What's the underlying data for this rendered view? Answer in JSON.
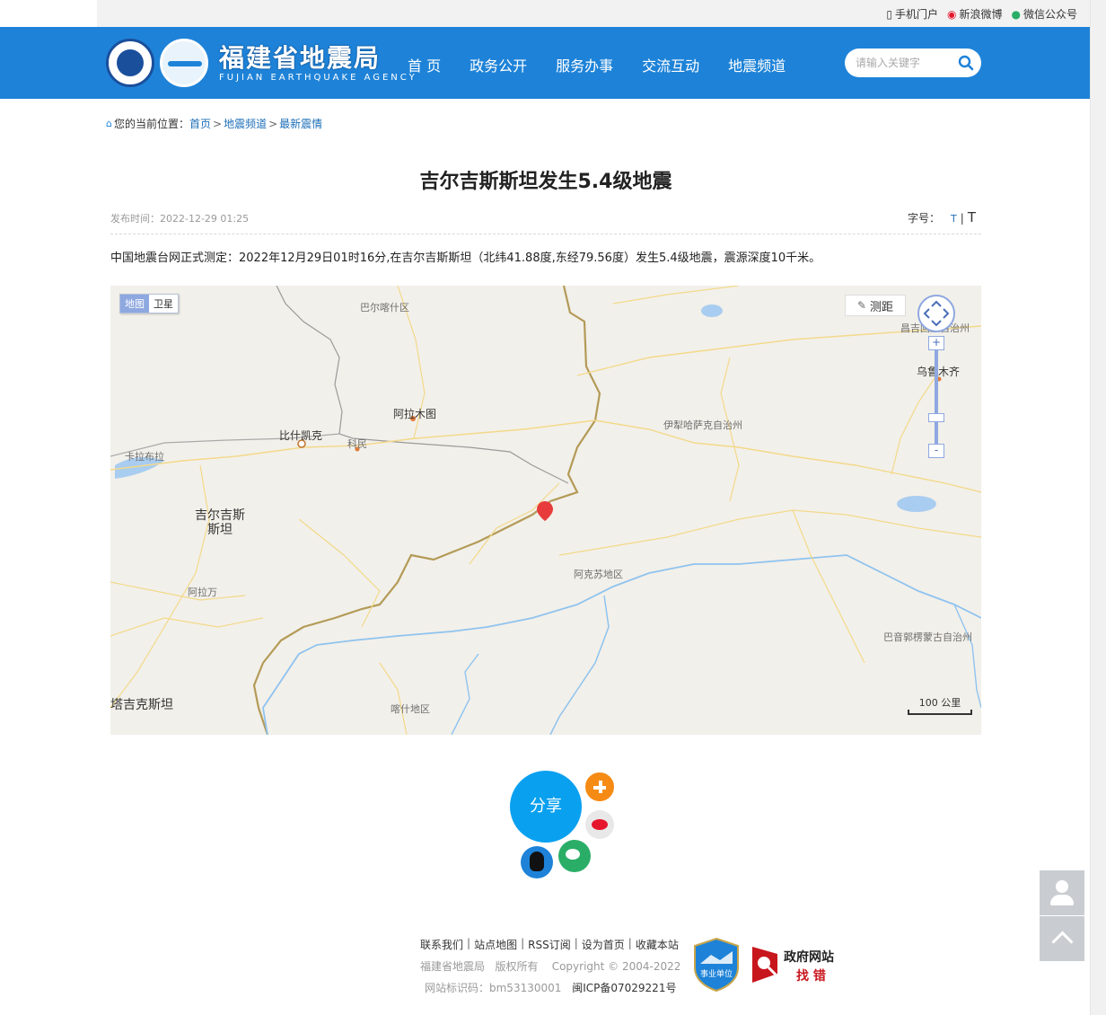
{
  "top_bar": {
    "links": [
      {
        "label": "手机门户",
        "icon": "phone-icon"
      },
      {
        "label": "新浪微博",
        "icon": "weibo-icon"
      },
      {
        "label": "微信公众号",
        "icon": "wechat-icon"
      }
    ]
  },
  "header": {
    "logo_cn": "福建省地震局",
    "logo_en": "FUJIAN EARTHQUAKE AGENCY",
    "nav": [
      "首 页",
      "政务公开",
      "服务办事",
      "交流互动",
      "地震频道"
    ],
    "search_placeholder": "请输入关键字",
    "brand_color": "#1e83d8"
  },
  "breadcrumb": {
    "prefix": "您的当前位置：",
    "items": [
      "首页",
      "地震频道",
      "最新震情"
    ],
    "separator": ">"
  },
  "article": {
    "title": "吉尔吉斯斯坦发生5.4级地震",
    "publish_time": "发布时间：2022-12-29 01:25",
    "font_label": "字号：",
    "font_small": "T",
    "font_sep": "|",
    "font_large": "T",
    "body": "中国地震台网正式测定：2022年12月29日01时16分,在吉尔吉斯斯坦（北纬41.88度,东经79.56度）发生5.4级地震，震源深度10千米。"
  },
  "map": {
    "type_map": "地图",
    "type_satellite": "卫星",
    "measure": "测距",
    "zoom_in": "+",
    "zoom_out": "-",
    "scale": "100 公里",
    "labels": {
      "kashgar": "巴尔喀什区",
      "changji": "昌吉回族自治州",
      "urumqi": "乌鲁木齐",
      "almaty": "阿拉木图",
      "ili": "伊犁哈萨克自治州",
      "bishkek": "比什凯克",
      "kemin": "科民",
      "karabalta": "卡拉布拉",
      "kyrgyzstan": "吉尔吉斯\n斯坦",
      "aksu": "阿克苏地区",
      "jalalabad": "阿拉万",
      "bayingol": "巴音郭楞蒙古自治州",
      "tajikistan": "塔吉克斯坦",
      "kashi": "喀什地区"
    }
  },
  "share": {
    "label": "分享"
  },
  "footer": {
    "links": [
      "联系我们",
      "站点地图",
      "RSS订阅",
      "设为首页",
      "收藏本站"
    ],
    "copyright": "福建省地震局   版权所有    Copyright © 2004-2022",
    "site_id": "网站标识码：bm53130001",
    "icp": "闽ICP备07029221号",
    "badge_unit": "事业单位",
    "gov_title": "政府网站",
    "gov_error": "找 错"
  }
}
